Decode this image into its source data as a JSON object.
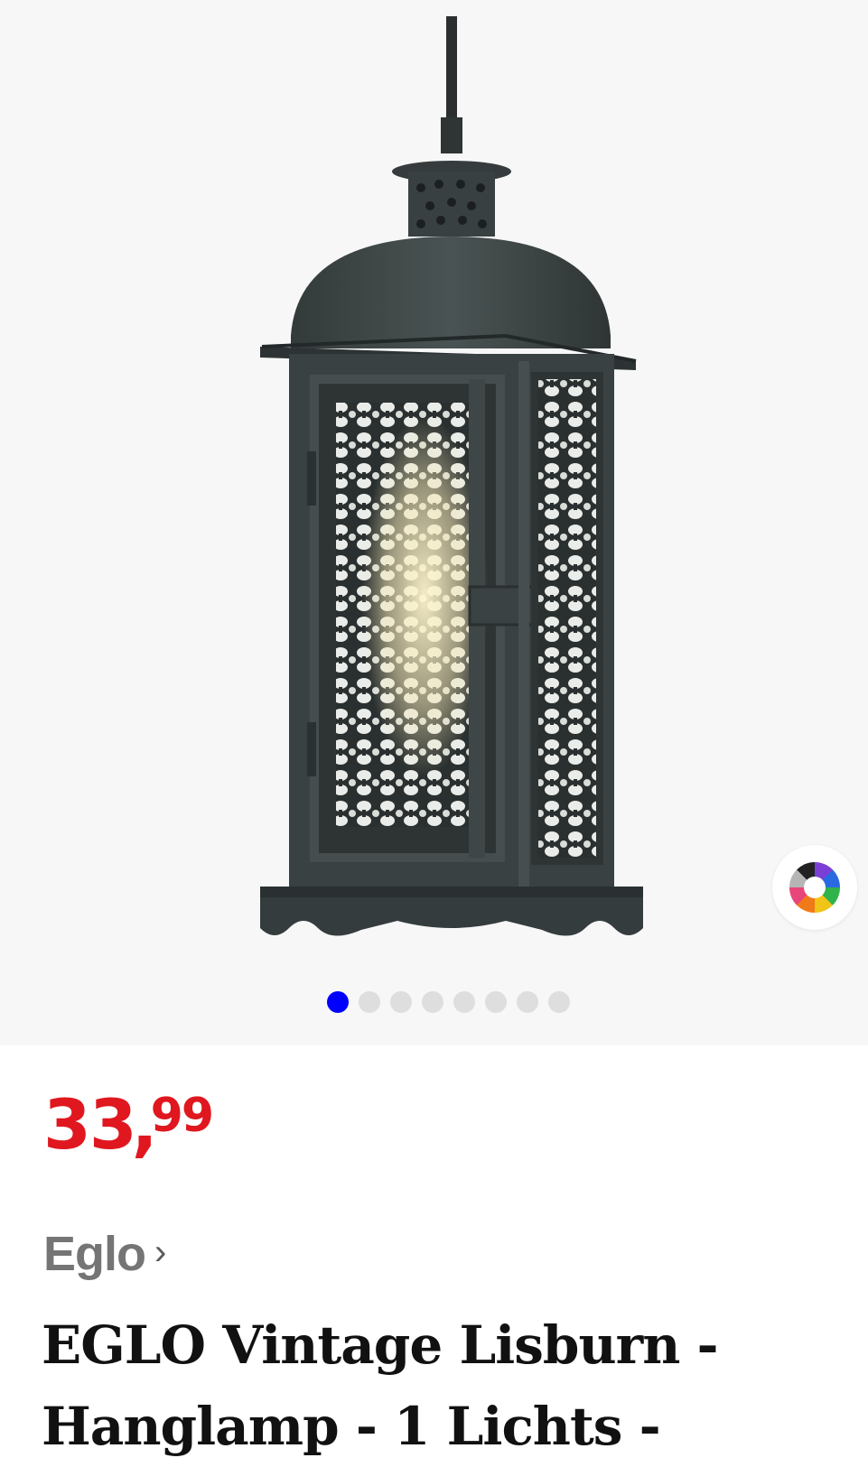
{
  "gallery": {
    "image_alt": "EGLO Vintage Lisburn hanglamp",
    "dot_count": 8,
    "active_index": 0,
    "active_color": "#0000ff",
    "inactive_color": "#dedede",
    "color_picker_icon": "color-wheel-icon"
  },
  "product": {
    "price": {
      "whole": "33",
      "separator": ",",
      "cents": "99",
      "color": "#e0171f"
    },
    "brand": {
      "name": "Eglo",
      "chevron": "›"
    },
    "title": "EGLO Vintage Lisburn - Hanglamp - 1 Lichts -"
  }
}
